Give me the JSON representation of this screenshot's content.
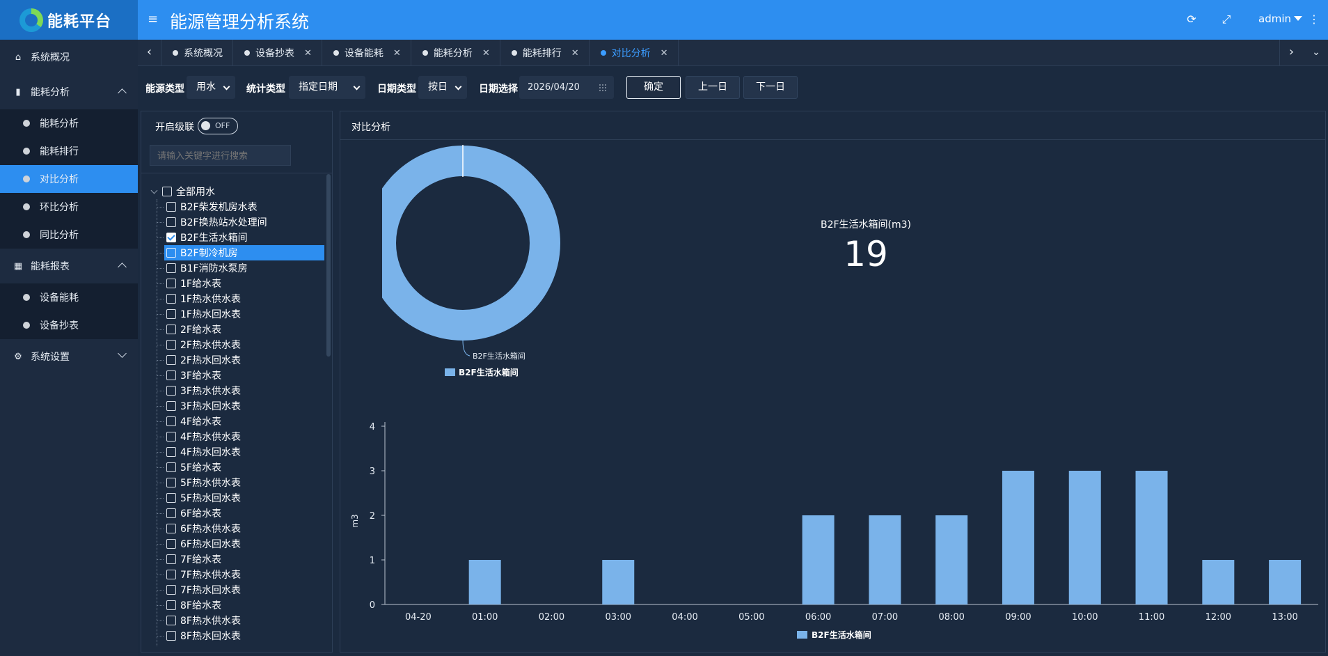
{
  "header": {
    "logo_text": "能耗平台",
    "system_title": "能源管理分析系统",
    "user": "admin",
    "icons": [
      "menu-icon",
      "refresh-icon",
      "fullscreen-icon",
      "more-icon"
    ]
  },
  "sidebar": {
    "groups": [
      {
        "label": "系统概况",
        "icon": "home-icon"
      },
      {
        "label": "能耗分析",
        "icon": "bar-chart-icon",
        "expanded": true,
        "items": [
          {
            "label": "能耗分析",
            "active": false
          },
          {
            "label": "能耗排行",
            "active": false
          },
          {
            "label": "对比分析",
            "active": true
          },
          {
            "label": "环比分析",
            "active": false
          },
          {
            "label": "同比分析",
            "active": false
          }
        ]
      },
      {
        "label": "能耗报表",
        "icon": "table-icon",
        "expanded": true,
        "items": [
          {
            "label": "设备能耗",
            "active": false
          },
          {
            "label": "设备抄表",
            "active": false
          }
        ]
      },
      {
        "label": "系统设置",
        "icon": "gear-icon",
        "expanded": false
      }
    ]
  },
  "tabs": [
    {
      "label": "系统概况",
      "closable": false,
      "active": false
    },
    {
      "label": "设备抄表",
      "closable": true,
      "active": false
    },
    {
      "label": "设备能耗",
      "closable": true,
      "active": false
    },
    {
      "label": "能耗分析",
      "closable": true,
      "active": false
    },
    {
      "label": "能耗排行",
      "closable": true,
      "active": false
    },
    {
      "label": "对比分析",
      "closable": true,
      "active": true
    }
  ],
  "filters": {
    "energy_type_label": "能源类型",
    "energy_type_value": "用水",
    "stat_type_label": "统计类型",
    "stat_type_value": "指定日期",
    "date_type_label": "日期类型",
    "date_type_value": "按日",
    "date_select_label": "日期选择",
    "date_value": "2026/04/20",
    "confirm_label": "确定",
    "prev_day_label": "上一日",
    "next_day_label": "下一日"
  },
  "tree": {
    "cascade_label": "开启级联",
    "cascade_state": "OFF",
    "search_placeholder": "请输入关键字进行搜索",
    "root_label": "全部用水",
    "nodes": [
      {
        "label": "B2F柴发机房水表",
        "checked": false
      },
      {
        "label": "B2F换热站水处理间",
        "checked": false
      },
      {
        "label": "B2F生活水箱间",
        "checked": true
      },
      {
        "label": "B2F制冷机房",
        "checked": false,
        "selected": true
      },
      {
        "label": "B1F消防水泵房",
        "checked": false
      },
      {
        "label": "1F给水表",
        "checked": false
      },
      {
        "label": "1F热水供水表",
        "checked": false
      },
      {
        "label": "1F热水回水表",
        "checked": false
      },
      {
        "label": "2F给水表",
        "checked": false
      },
      {
        "label": "2F热水供水表",
        "checked": false
      },
      {
        "label": "2F热水回水表",
        "checked": false
      },
      {
        "label": "3F给水表",
        "checked": false
      },
      {
        "label": "3F热水供水表",
        "checked": false
      },
      {
        "label": "3F热水回水表",
        "checked": false
      },
      {
        "label": "4F给水表",
        "checked": false
      },
      {
        "label": "4F热水供水表",
        "checked": false
      },
      {
        "label": "4F热水回水表",
        "checked": false
      },
      {
        "label": "5F给水表",
        "checked": false
      },
      {
        "label": "5F热水供水表",
        "checked": false
      },
      {
        "label": "5F热水回水表",
        "checked": false
      },
      {
        "label": "6F给水表",
        "checked": false
      },
      {
        "label": "6F热水供水表",
        "checked": false
      },
      {
        "label": "6F热水回水表",
        "checked": false
      },
      {
        "label": "7F给水表",
        "checked": false
      },
      {
        "label": "7F热水供水表",
        "checked": false
      },
      {
        "label": "7F热水回水表",
        "checked": false
      },
      {
        "label": "8F给水表",
        "checked": false
      },
      {
        "label": "8F热水供水表",
        "checked": false
      },
      {
        "label": "8F热水回水表",
        "checked": false
      }
    ]
  },
  "panel": {
    "title": "对比分析",
    "kpi_label": "B2F生活水箱间(m3)",
    "kpi_value": "19"
  },
  "colors": {
    "accent": "#2d8ef0",
    "series": "#7ab3ea",
    "background": "#1b2a3f"
  },
  "chart_data": [
    {
      "type": "pie",
      "title": "",
      "donut": true,
      "slices": [
        {
          "name": "B2F生活水箱间",
          "value": 19
        }
      ],
      "legend": [
        "B2F生活水箱间"
      ],
      "legend_placement": "bottom-left"
    },
    {
      "type": "bar",
      "title": "",
      "categories": [
        "04-20",
        "01:00",
        "02:00",
        "03:00",
        "04:00",
        "05:00",
        "06:00",
        "07:00",
        "08:00",
        "09:00",
        "10:00",
        "11:00",
        "12:00",
        "13:00"
      ],
      "series": [
        {
          "name": "B2F生活水箱间",
          "values": [
            0,
            1,
            0,
            1,
            0,
            0,
            2,
            2,
            2,
            3,
            3,
            3,
            1,
            1
          ]
        }
      ],
      "xlabel": "",
      "ylabel": "m3",
      "ylim": [
        0,
        4
      ],
      "yticks": [
        0,
        1,
        2,
        3,
        4
      ],
      "grid": false,
      "legend_placement": "bottom"
    }
  ]
}
